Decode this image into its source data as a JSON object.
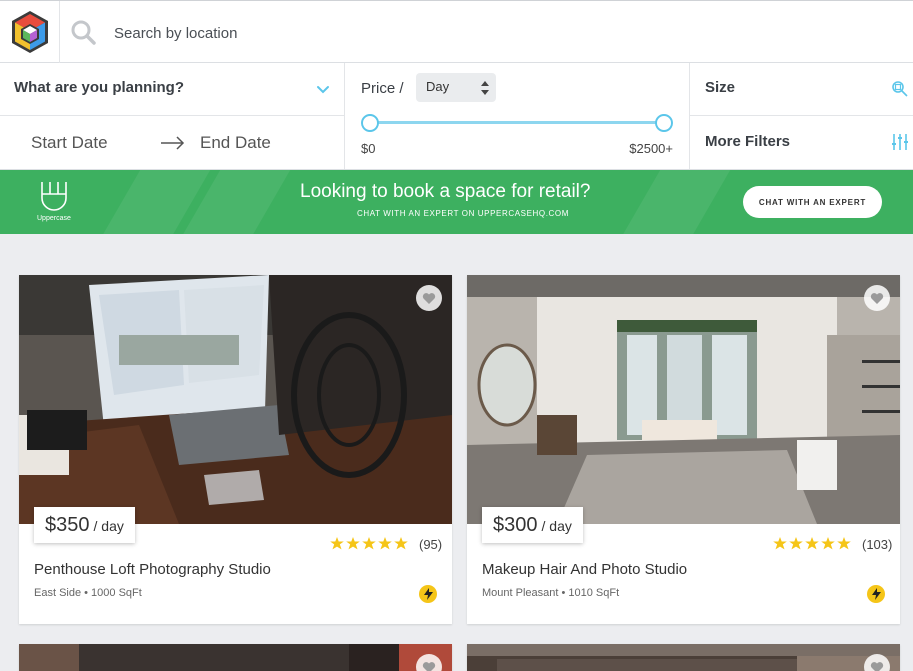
{
  "search": {
    "placeholder": "Search by location"
  },
  "filters": {
    "planning_label": "What are you planning?",
    "start_date": "Start Date",
    "end_date": "End Date",
    "price_label": "Price /",
    "price_period": "Day",
    "price_min": "$0",
    "price_max": "$2500+",
    "size_label": "Size",
    "more_filters_label": "More Filters"
  },
  "banner": {
    "logo_text": "Uppercase",
    "title": "Looking to book a space for retail?",
    "subtitle": "CHAT WITH AN EXPERT ON UPPERCASEHQ.COM",
    "cta": "CHAT WITH AN EXPERT"
  },
  "listings": [
    {
      "price": "$350",
      "unit": "/ day",
      "rating": 5,
      "reviews": "(95)",
      "title": "Penthouse Loft Photography Studio",
      "meta": "East Side • 1000 SqFt"
    },
    {
      "price": "$300",
      "unit": "/ day",
      "rating": 5,
      "reviews": "(103)",
      "title": "Makeup Hair And Photo Studio",
      "meta": "Mount Pleasant • 1010 SqFt"
    }
  ],
  "colors": {
    "accent": "#5bc6ea",
    "banner_green": "#3db060",
    "star_yellow": "#f5c518"
  },
  "icons": [
    "app-logo-icon",
    "search-icon",
    "chevron-down-icon",
    "arrow-right-icon",
    "size-icon",
    "sliders-icon",
    "heart-icon",
    "star-icon",
    "lightning-icon"
  ]
}
